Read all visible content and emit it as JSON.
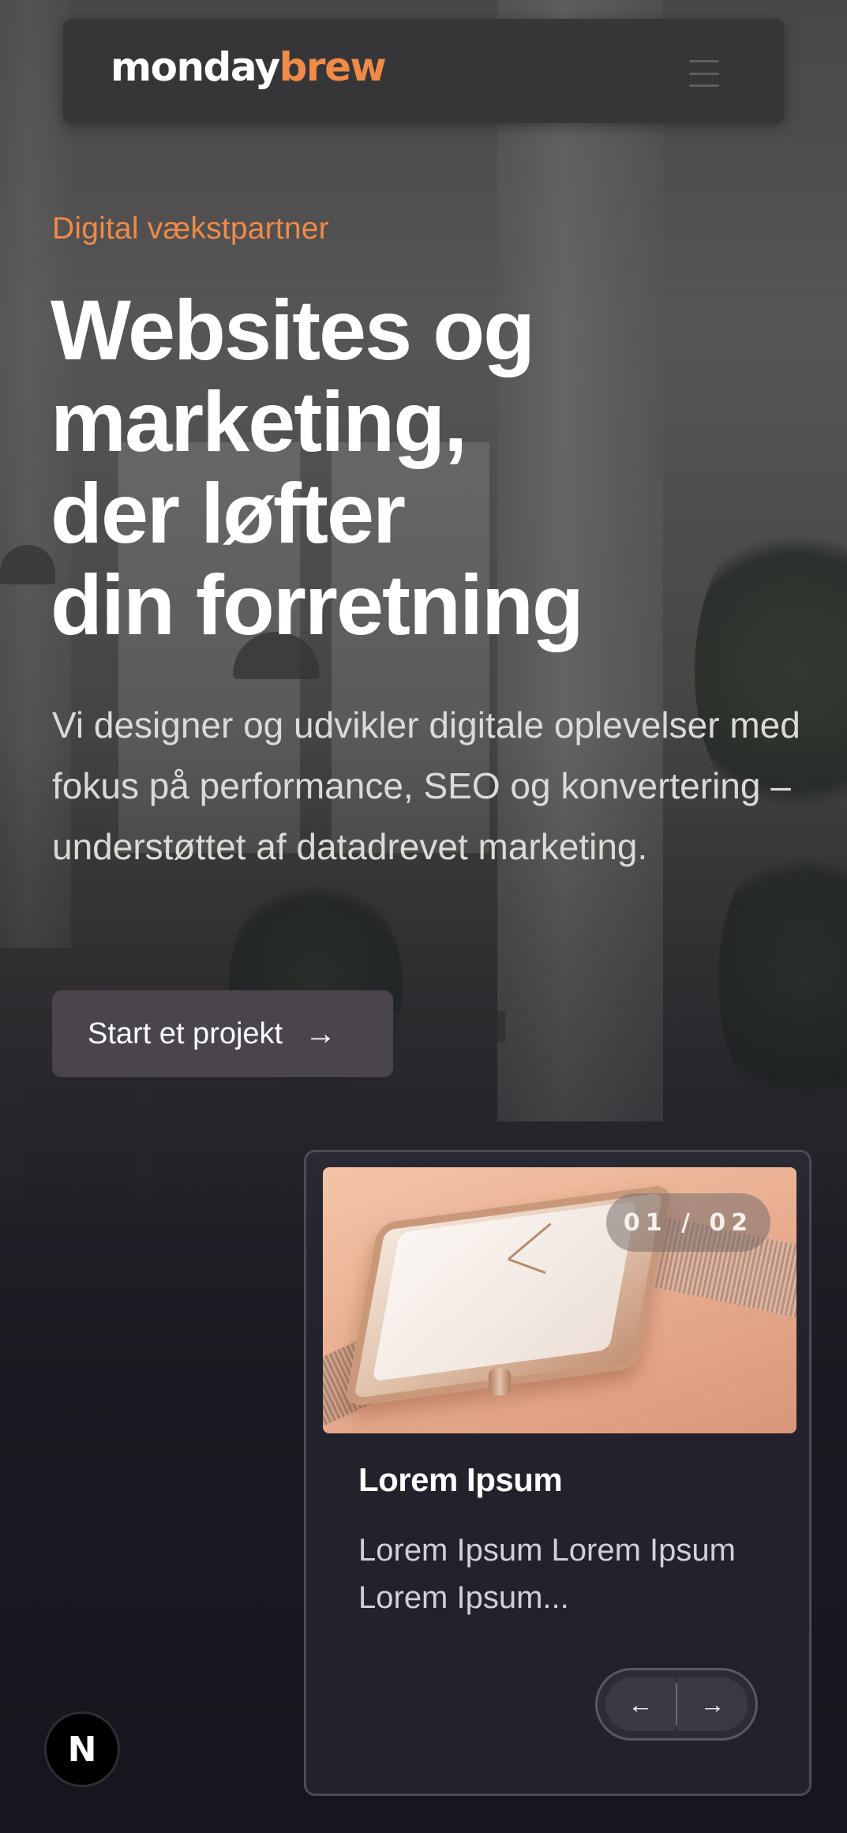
{
  "header": {
    "logo_part1": "monday",
    "logo_part2": "brew",
    "menu_icon": "hamburger-menu-icon"
  },
  "hero": {
    "eyebrow": "Digital vækstpartner",
    "headline_lines": [
      "Websites og",
      "marketing,",
      "der løfter",
      "din forretning"
    ],
    "lead": "Vi designer og udvikler digitale oplevelser med fokus på performance, SEO og konvertering – understøttet af datadrevet marketing.",
    "cta_label": "Start et projekt",
    "cta_icon": "arrow-right-icon"
  },
  "slider": {
    "counter": "01 / 02",
    "card_title": "Lorem Ipsum",
    "card_text": "Lorem Ipsum Lorem Ipsum Lorem Ipsum...",
    "prev_icon": "arrow-left-icon",
    "next_icon": "arrow-right-icon",
    "image_subject": "rose gold wristwatch"
  },
  "badge": {
    "label": "N",
    "icon": "nextjs-icon"
  },
  "colors": {
    "accent": "#f08a48",
    "header_bg": "#343436",
    "cta_bg": "#4a454d",
    "card_border": "#4d4c55",
    "page_bg": "#1a1a22"
  }
}
